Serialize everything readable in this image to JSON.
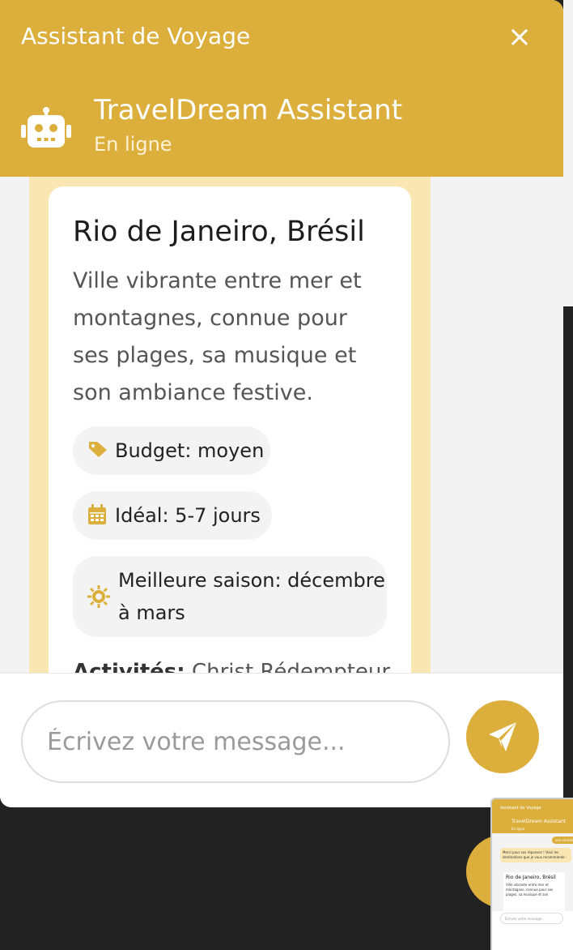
{
  "header": {
    "title": "Assistant de Voyage",
    "close_icon": "×"
  },
  "agent": {
    "name": "TravelDream Assistant",
    "status": "En ligne",
    "avatar_icon": "robot-icon"
  },
  "destination_card": {
    "title": "Rio de Janeiro, Brésil",
    "description": "Ville vibrante entre mer et montagnes, connue pour ses plages, sa musique et son ambiance festive.",
    "tags": [
      {
        "icon": "tag-icon",
        "text": "Budget: moyen"
      },
      {
        "icon": "calendar-icon",
        "text": "Idéal: 5-7 jours"
      },
      {
        "icon": "sun-icon",
        "text_line1": "Meilleure saison: décembre",
        "text_line2": "à mars"
      }
    ],
    "activities_label": "Activités:",
    "activities_text": "Christ Rédempteur"
  },
  "composer": {
    "placeholder": "Écrivez votre message...",
    "send_icon": "paper-plane-icon"
  },
  "theme": {
    "accent": "#dcae3b",
    "bubble": "#f9e6b3",
    "background": "#f3f3f3",
    "page_dark": "#222222"
  },
  "preview": {
    "title": "Assistant de Voyage",
    "agent_name": "TravelDream Assistant",
    "agent_status": "En ligne",
    "user_message": "une semain",
    "reply": "Merci pour vos réponses ! Voici les destinations que je vous recommande :",
    "card_title": "Rio de Janeiro, Brésil",
    "card_desc": "Ville vibrante entre mer et montagnes, connue pour ses plages, sa musique et son",
    "input_placeholder": "Écrivez votre message..."
  }
}
